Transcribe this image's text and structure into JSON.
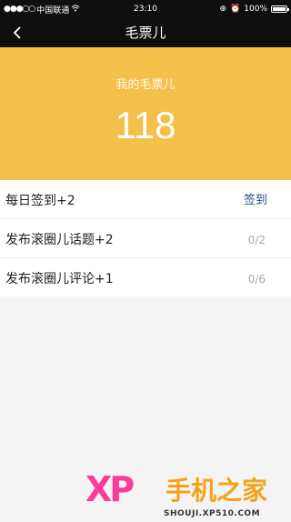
{
  "status_bar": {
    "carrier": "中国联通",
    "time": "23:10",
    "battery_percent": "100%",
    "battery_level": 1.0
  },
  "nav": {
    "title": "毛票儿"
  },
  "hero": {
    "label": "我的毛票儿",
    "value": "118",
    "background": "#f5c04a"
  },
  "tasks": [
    {
      "label": "每日签到+2",
      "action": "签到"
    },
    {
      "label": "发布滚圈儿话题+2",
      "progress": "0/2"
    },
    {
      "label": "发布滚圈儿评论+1",
      "progress": "0/6"
    }
  ],
  "watermark": {
    "logo": "XP",
    "brand": "手机之家",
    "url": "SHOUJI.XP510.COM"
  },
  "colors": {
    "accent": "#f5c04a",
    "link": "#2d4a8a",
    "nav_bg": "#0f0f0f"
  }
}
